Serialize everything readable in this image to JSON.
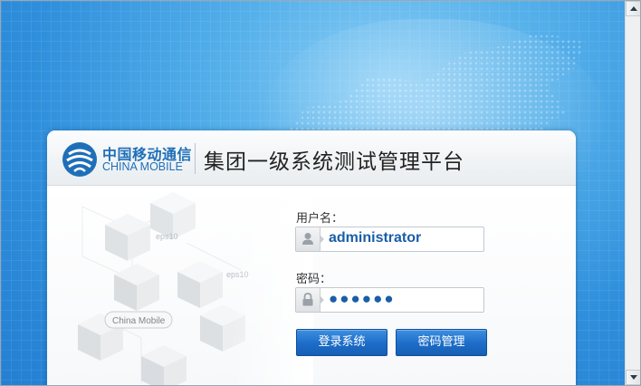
{
  "header": {
    "brand_cn": "中国移动通信",
    "brand_en": "CHINA MOBILE",
    "platform_title": "集团一级系统测试管理平台"
  },
  "illustration": {
    "tag_1": "eps10",
    "tag_2": "eps10",
    "brand_label": "China Mobile"
  },
  "login": {
    "username_label": "用户名：",
    "username_value": "administrator",
    "password_label": "密码：",
    "password_value": "●●●●●●",
    "login_button": "登录系统",
    "password_manage_button": "密码管理"
  },
  "colors": {
    "background": "#2f8fdc",
    "brand_blue": "#1f6fb8",
    "button_blue": "#1c6cc8",
    "input_text": "#1a5ea8"
  },
  "icons": {
    "username": "user-icon",
    "password": "lock-icon",
    "logo": "china-mobile-logo-icon"
  }
}
